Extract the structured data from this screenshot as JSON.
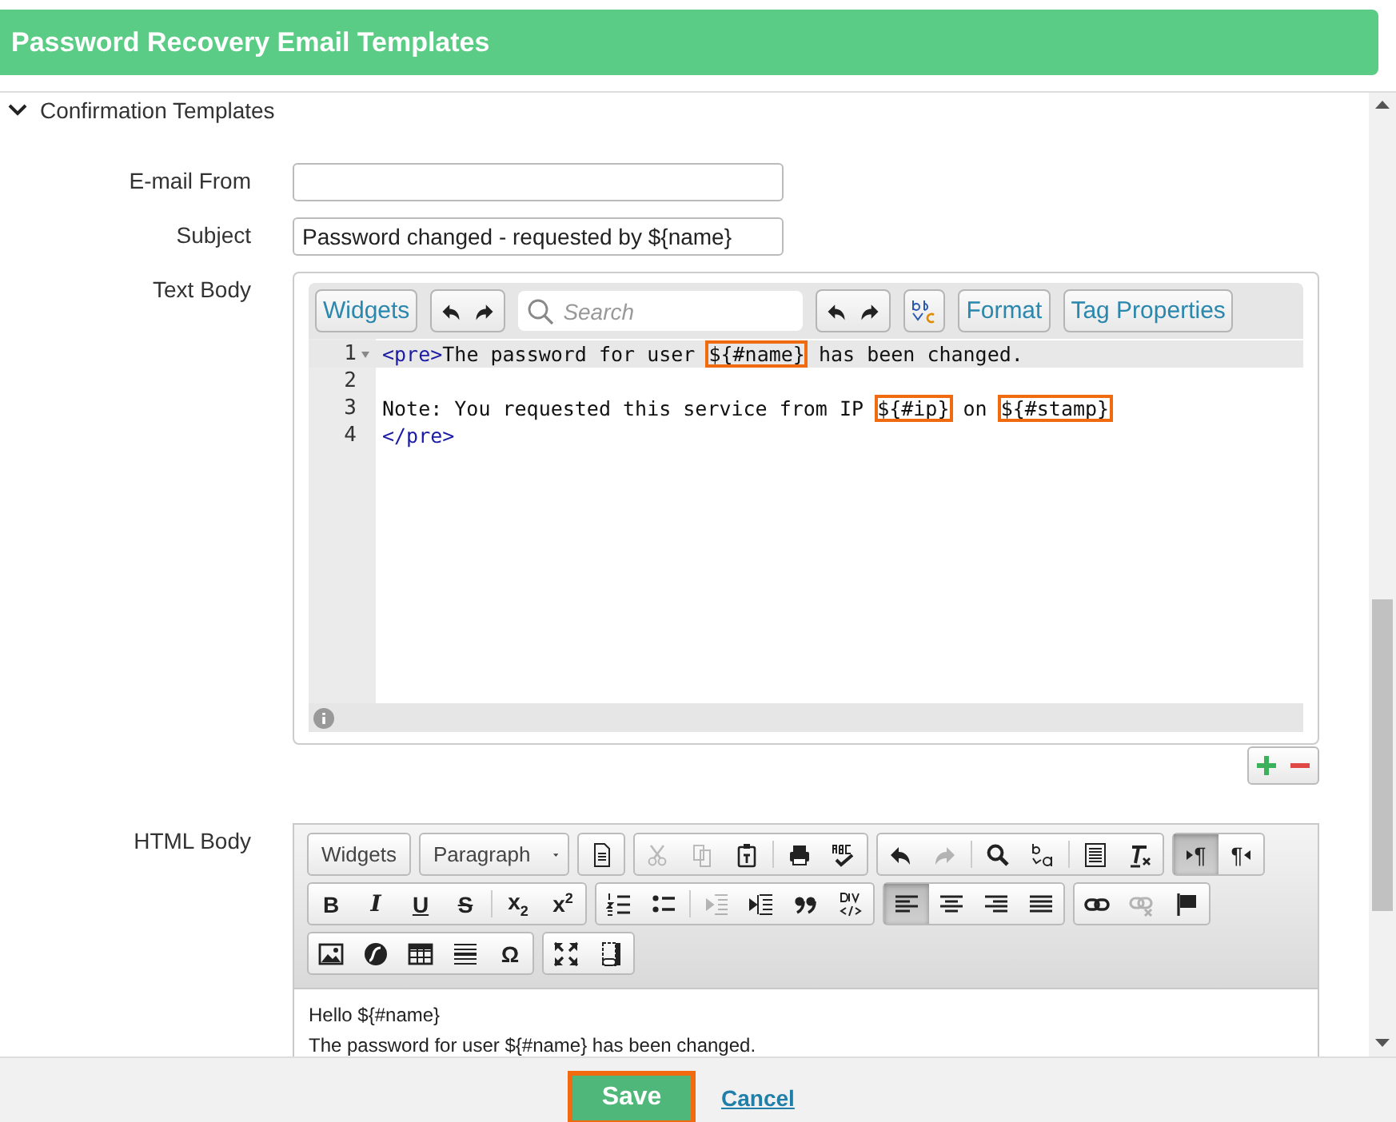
{
  "header": {
    "title": "Password Recovery Email Templates"
  },
  "section": {
    "title": "Confirmation Templates",
    "expanded": true
  },
  "fields": [
    {
      "label": "E-mail From"
    },
    {
      "label": "Subject",
      "value": "Password changed - requested by ${name}"
    }
  ],
  "text_body": {
    "label": "Text Body",
    "toolbar": [
      {
        "kind": "text",
        "label": "Widgets"
      },
      {
        "kind": "undo-redo"
      },
      {
        "kind": "search",
        "placeholder": "Search"
      },
      {
        "kind": "undo-redo"
      },
      {
        "kind": "spellcheck"
      },
      {
        "kind": "text",
        "label": "Format"
      },
      {
        "kind": "text",
        "label": "Tag Properties"
      }
    ],
    "lines": [
      {
        "number": "1",
        "active": true,
        "foldable": true,
        "tokens": [
          {
            "kind": "tag",
            "text": "<pre>",
            "highlighted": false
          },
          {
            "kind": "plain",
            "text": "The password for user ",
            "highlighted": false
          },
          {
            "kind": "plain",
            "text": "${#name}",
            "highlighted": true
          },
          {
            "kind": "plain",
            "text": " has been changed.",
            "highlighted": false
          }
        ]
      },
      {
        "number": "2",
        "active": false,
        "foldable": false
      },
      {
        "number": "3",
        "active": false,
        "foldable": false,
        "tokens": [
          {
            "kind": "plain",
            "text": "Note: You requested this service from IP ",
            "highlighted": false
          },
          {
            "kind": "plain",
            "text": "${#ip}",
            "highlighted": true
          },
          {
            "kind": "plain",
            "text": " on ",
            "highlighted": false
          },
          {
            "kind": "plain",
            "text": "${#stamp}",
            "highlighted": true
          }
        ]
      },
      {
        "number": "4",
        "active": false,
        "foldable": false,
        "tokens": [
          {
            "kind": "tag",
            "text": "</pre>",
            "highlighted": false
          }
        ]
      }
    ]
  },
  "html_body": {
    "label": "HTML Body",
    "toolbar": [
      [
        [
          {
            "kind": "text",
            "label": "Widgets",
            "disabled": false,
            "pressed": false
          }
        ],
        [
          {
            "kind": "dropdown",
            "label": "Paragraph",
            "disabled": false,
            "pressed": false
          }
        ],
        [
          {
            "kind": "source",
            "disabled": false,
            "pressed": false
          }
        ],
        [
          {
            "kind": "cut",
            "disabled": true,
            "pressed": false
          },
          {
            "kind": "copy",
            "disabled": true,
            "pressed": false
          },
          {
            "kind": "paste",
            "disabled": false,
            "pressed": false
          },
          {
            "kind": "sep"
          },
          {
            "kind": "print",
            "disabled": false,
            "pressed": false
          },
          {
            "kind": "spell",
            "disabled": false,
            "pressed": false
          }
        ],
        [
          {
            "kind": "undo",
            "disabled": false,
            "pressed": false
          },
          {
            "kind": "redo",
            "disabled": true,
            "pressed": false
          },
          {
            "kind": "sep"
          },
          {
            "kind": "find",
            "disabled": false,
            "pressed": false
          },
          {
            "kind": "replace",
            "disabled": false,
            "pressed": false
          },
          {
            "kind": "sep"
          },
          {
            "kind": "selectall",
            "disabled": false,
            "pressed": false
          },
          {
            "kind": "clearformat",
            "disabled": false,
            "pressed": false
          }
        ],
        [
          {
            "kind": "ltr",
            "glyph": "¶",
            "disabled": false,
            "pressed": true
          },
          {
            "kind": "rtl",
            "glyph": "¶",
            "disabled": false,
            "pressed": false
          }
        ]
      ],
      [
        [
          {
            "kind": "bold",
            "glyph": "B",
            "disabled": false,
            "pressed": false
          },
          {
            "kind": "italic",
            "glyph": "I",
            "disabled": false,
            "pressed": false
          },
          {
            "kind": "underline",
            "glyph": "U",
            "disabled": false,
            "pressed": false
          },
          {
            "kind": "strike",
            "glyph": "S",
            "disabled": false,
            "pressed": false
          },
          {
            "kind": "sep"
          },
          {
            "kind": "script",
            "glyph": "x$_{2}$",
            "disabled": false,
            "pressed": false
          },
          {
            "kind": "script",
            "glyph": "x$^{2}$",
            "disabled": false,
            "pressed": false
          }
        ],
        [
          {
            "kind": "ol",
            "disabled": false,
            "pressed": false
          },
          {
            "kind": "ul",
            "disabled": false,
            "pressed": false
          },
          {
            "kind": "sep"
          },
          {
            "kind": "outdent",
            "disabled": true,
            "pressed": false
          },
          {
            "kind": "indent",
            "disabled": false,
            "pressed": false
          },
          {
            "kind": "quote",
            "disabled": false,
            "pressed": false
          },
          {
            "kind": "div",
            "disabled": false,
            "pressed": false
          }
        ],
        [
          {
            "kind": "alignleft",
            "disabled": false,
            "pressed": true
          },
          {
            "kind": "aligncenter",
            "disabled": false,
            "pressed": false
          },
          {
            "kind": "alignright",
            "disabled": false,
            "pressed": false
          },
          {
            "kind": "justify",
            "disabled": false,
            "pressed": false
          }
        ],
        [
          {
            "kind": "link",
            "disabled": false,
            "pressed": false
          },
          {
            "kind": "unlink",
            "disabled": true,
            "pressed": false
          },
          {
            "kind": "flag",
            "disabled": false,
            "pressed": false
          }
        ]
      ],
      [
        [
          {
            "kind": "image",
            "disabled": false,
            "pressed": false
          },
          {
            "kind": "flash",
            "disabled": false,
            "pressed": false
          },
          {
            "kind": "table",
            "disabled": false,
            "pressed": false
          },
          {
            "kind": "hr",
            "disabled": false,
            "pressed": false
          },
          {
            "kind": "special",
            "glyph": "Ω",
            "disabled": false,
            "pressed": false
          }
        ],
        [
          {
            "kind": "maximize",
            "disabled": false,
            "pressed": false
          },
          {
            "kind": "blocks",
            "disabled": false,
            "pressed": false
          }
        ]
      ]
    ],
    "paragraphs": [
      "Hello ${#name}",
      "The password for user ${#name} has been changed."
    ]
  },
  "footer": {
    "save": "Save",
    "cancel": "Cancel"
  }
}
